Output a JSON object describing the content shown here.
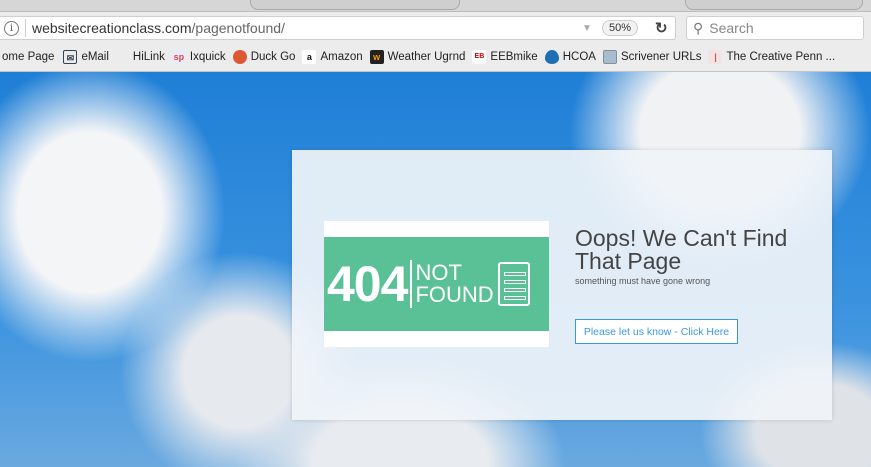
{
  "browser": {
    "url_domain": "websitecreationclass.com",
    "url_path": "/pagenotfound/",
    "zoom": "50%",
    "search_placeholder": "Search",
    "bookmarks": [
      {
        "label": "ome Page"
      },
      {
        "label": "eMail"
      },
      {
        "label": "HiLink"
      },
      {
        "label": "Ixquick"
      },
      {
        "label": "Duck Go"
      },
      {
        "label": "Amazon"
      },
      {
        "label": "Weather Ugrnd"
      },
      {
        "label": "EEBmike"
      },
      {
        "label": "HCOA"
      },
      {
        "label": "Scrivener URLs"
      },
      {
        "label": "The Creative Penn ..."
      }
    ]
  },
  "page": {
    "image_404": "404",
    "image_not": "NOT",
    "image_found": "FOUND",
    "title": "Oops! We Can't Find That Page",
    "subtitle": "something must have gone wrong",
    "button": "Please let us know - Click Here"
  }
}
